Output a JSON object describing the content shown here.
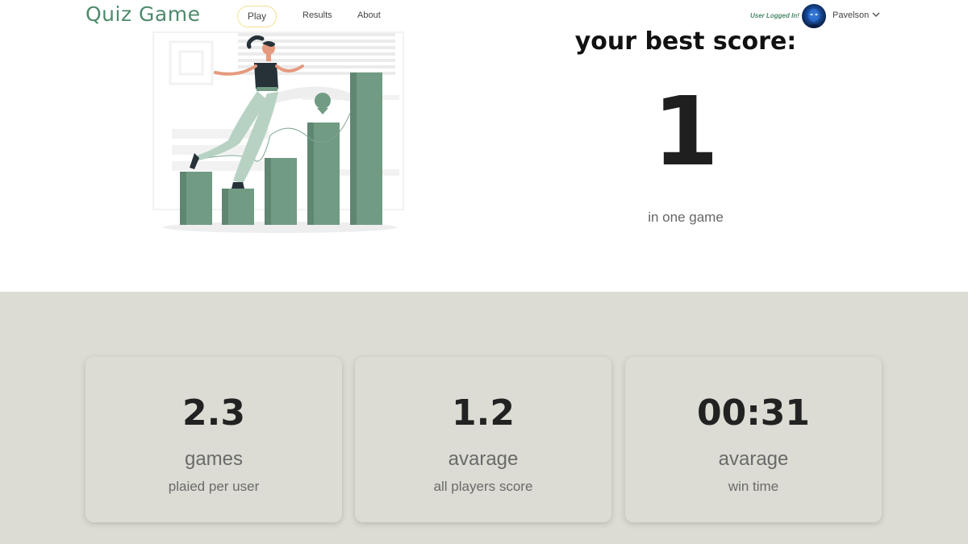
{
  "header": {
    "brand": "Quiz Game",
    "nav": {
      "play": "Play",
      "results": "Results",
      "about": "About"
    },
    "status_text": "User Logged In!",
    "username": "Pavelson"
  },
  "hero": {
    "best_title": "your best score:",
    "best_value": "1",
    "best_sub": "in one game"
  },
  "stats": [
    {
      "value": "2.3",
      "label": "games",
      "sub": "plaied per user"
    },
    {
      "value": "1.2",
      "label": "avarage",
      "sub": "all players score"
    },
    {
      "value": "00:31",
      "label": "avarage",
      "sub": "win time"
    }
  ],
  "colors": {
    "brand": "#4e8a6c",
    "bars": "#729b84",
    "stats_bg": "#dcdcd4",
    "play_border": "#f2e08e"
  }
}
